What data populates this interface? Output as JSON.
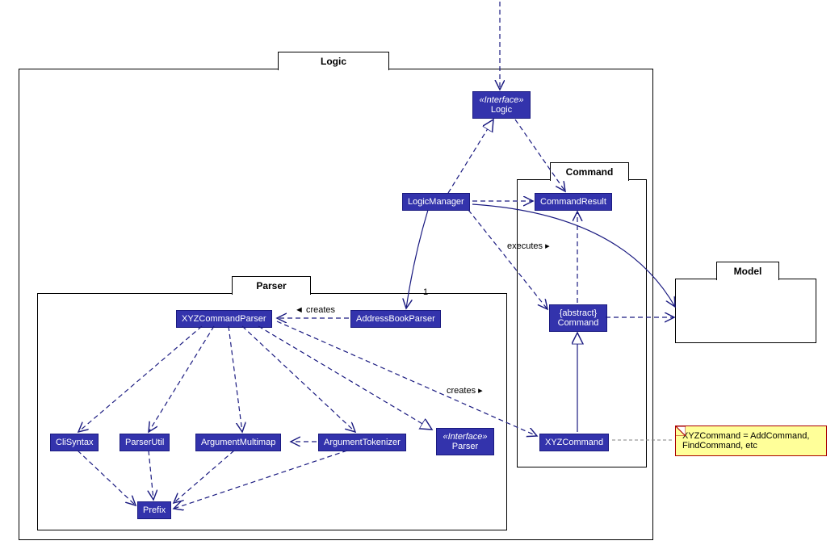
{
  "packages": {
    "logic_title": "Logic",
    "parser_title": "Parser",
    "command_title": "Command",
    "model_title": "Model"
  },
  "nodes": {
    "logic_interface": {
      "stereo": "«Interface»",
      "name": "Logic"
    },
    "logic_manager": "LogicManager",
    "command_result": "CommandResult",
    "abstract_command": {
      "abstract": "{abstract}",
      "name": "Command"
    },
    "xyz_command": "XYZCommand",
    "address_book_parser": "AddressBookParser",
    "xyz_command_parser": "XYZCommandParser",
    "cli_syntax": "CliSyntax",
    "parser_util": "ParserUtil",
    "argument_multimap": "ArgumentMultimap",
    "argument_tokenizer": "ArgumentTokenizer",
    "parser_interface": {
      "stereo": "«Interface»",
      "name": "Parser"
    },
    "prefix": "Prefix"
  },
  "labels": {
    "creates_left": "◄ creates",
    "creates_right": "creates ▸",
    "executes": "executes ▸",
    "mult_1": "1"
  },
  "note": {
    "line1": "XYZCommand = AddCommand,",
    "line2": "FindCommand, etc"
  }
}
